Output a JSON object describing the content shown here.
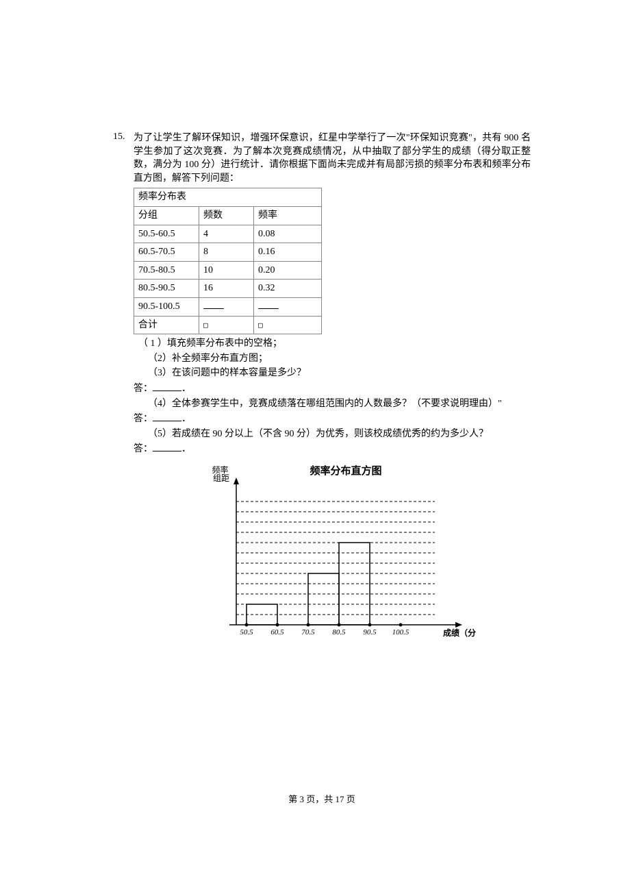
{
  "question": {
    "number": "15.",
    "intro1": "为了让学生了解环保知识，增强环保意识，红星中学举行了一次\"环保知识竞赛\"，共有 900 名学生参加了这次竞赛．为了解本次竞赛成绩情况，从中抽取了部分学生的成绩（得分取正整数，满分为 100 分）进行统计．请你根据下面尚未完成并有局部污损的频率分布表和频率分布直方图，解答下列问题：",
    "table_caption": "频率分布表",
    "table_headers": [
      "分组",
      "频数",
      "频率"
    ],
    "table_rows": [
      {
        "range": "50.5-60.5",
        "freq": "4",
        "rate": "0.08"
      },
      {
        "range": "60.5-70.5",
        "freq": "8",
        "rate": "0.16"
      },
      {
        "range": "70.5-80.5",
        "freq": "10",
        "rate": "0.20"
      },
      {
        "range": "80.5-90.5",
        "freq": "16",
        "rate": "0.32"
      },
      {
        "range": "90.5-100.5",
        "freq": "",
        "rate": ""
      }
    ],
    "total_label": "合计",
    "sub_q1": "（ 1 ）填充频率分布表中的空格；",
    "sub_q2": "（2）补全频率分布直方图；",
    "sub_q3": "（3）在该问题中的样本容量是多少？",
    "answer_prefix": "答：",
    "period": "．",
    "sub_q4": "（4）全体参赛学生中，竞赛成绩落在哪组范围内的人数最多？（不要求说明理由）\"",
    "sub_q5": "（5）若成绩在 90 分以上（不含 90 分）为优秀，则该校成绩优秀的约为多少人？"
  },
  "chart_data": {
    "type": "bar",
    "title": "频率分布直方图",
    "ylabel": "频率\n组距",
    "xlabel": "成绩（分）",
    "x_ticks": [
      "50.5",
      "60.5",
      "70.5",
      "80.5",
      "90.5",
      "100.5"
    ],
    "bars": [
      {
        "x_start": 50.5,
        "x_end": 60.5,
        "height": 0.08,
        "units": 2
      },
      {
        "x_start": 70.5,
        "x_end": 80.5,
        "height": 0.2,
        "units": 5
      },
      {
        "x_start": 80.5,
        "x_end": 90.5,
        "height": 0.32,
        "units": 8
      }
    ],
    "grid_lines": 12
  },
  "footer": {
    "page_label_prefix": "第 ",
    "page_num": "3",
    "page_label_mid": " 页，共 ",
    "page_total": "17",
    "page_label_suffix": " 页"
  }
}
